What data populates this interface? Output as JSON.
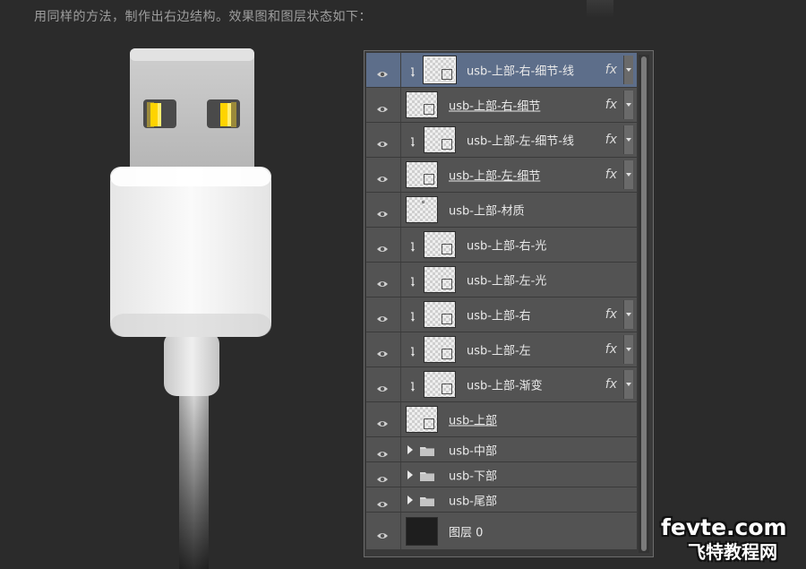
{
  "caption": "用同样的方法，制作出右边结构。效果图和图层状态如下：",
  "layers": [
    {
      "name": "usb-上部-右-细节-线",
      "clipped": true,
      "fx": true,
      "selected": true,
      "underline": false,
      "thumb": "shape"
    },
    {
      "name": "usb-上部-右-细节",
      "clipped": false,
      "fx": true,
      "selected": false,
      "underline": true,
      "thumb": "shape"
    },
    {
      "name": "usb-上部-左-细节-线",
      "clipped": true,
      "fx": true,
      "selected": false,
      "underline": false,
      "thumb": "shape"
    },
    {
      "name": "usb-上部-左-细节",
      "clipped": false,
      "fx": true,
      "selected": false,
      "underline": true,
      "thumb": "shape"
    },
    {
      "name": "usb-上部-材质",
      "clipped": false,
      "fx": false,
      "selected": false,
      "underline": false,
      "thumb": "pixel"
    },
    {
      "name": "usb-上部-右-光",
      "clipped": true,
      "fx": false,
      "selected": false,
      "underline": false,
      "thumb": "shape"
    },
    {
      "name": "usb-上部-左-光",
      "clipped": true,
      "fx": false,
      "selected": false,
      "underline": false,
      "thumb": "shape"
    },
    {
      "name": "usb-上部-右",
      "clipped": true,
      "fx": true,
      "selected": false,
      "underline": false,
      "thumb": "shape"
    },
    {
      "name": "usb-上部-左",
      "clipped": true,
      "fx": true,
      "selected": false,
      "underline": false,
      "thumb": "shape"
    },
    {
      "name": "usb-上部-渐变",
      "clipped": true,
      "fx": true,
      "selected": false,
      "underline": false,
      "thumb": "shape"
    },
    {
      "name": "usb-上部",
      "clipped": false,
      "fx": false,
      "selected": false,
      "underline": true,
      "thumb": "shape"
    }
  ],
  "groups": [
    {
      "name": "usb-中部"
    },
    {
      "name": "usb-下部"
    },
    {
      "name": "usb-尾部"
    }
  ],
  "background_layer": {
    "name": "图层 0"
  },
  "fx_label": "fx",
  "watermark": {
    "line1": "fevte.com",
    "line2": "飞特教程网"
  },
  "colors": {
    "selected": "#5d6e8a",
    "row": "#535353",
    "connector_contact": "#ffd400"
  }
}
